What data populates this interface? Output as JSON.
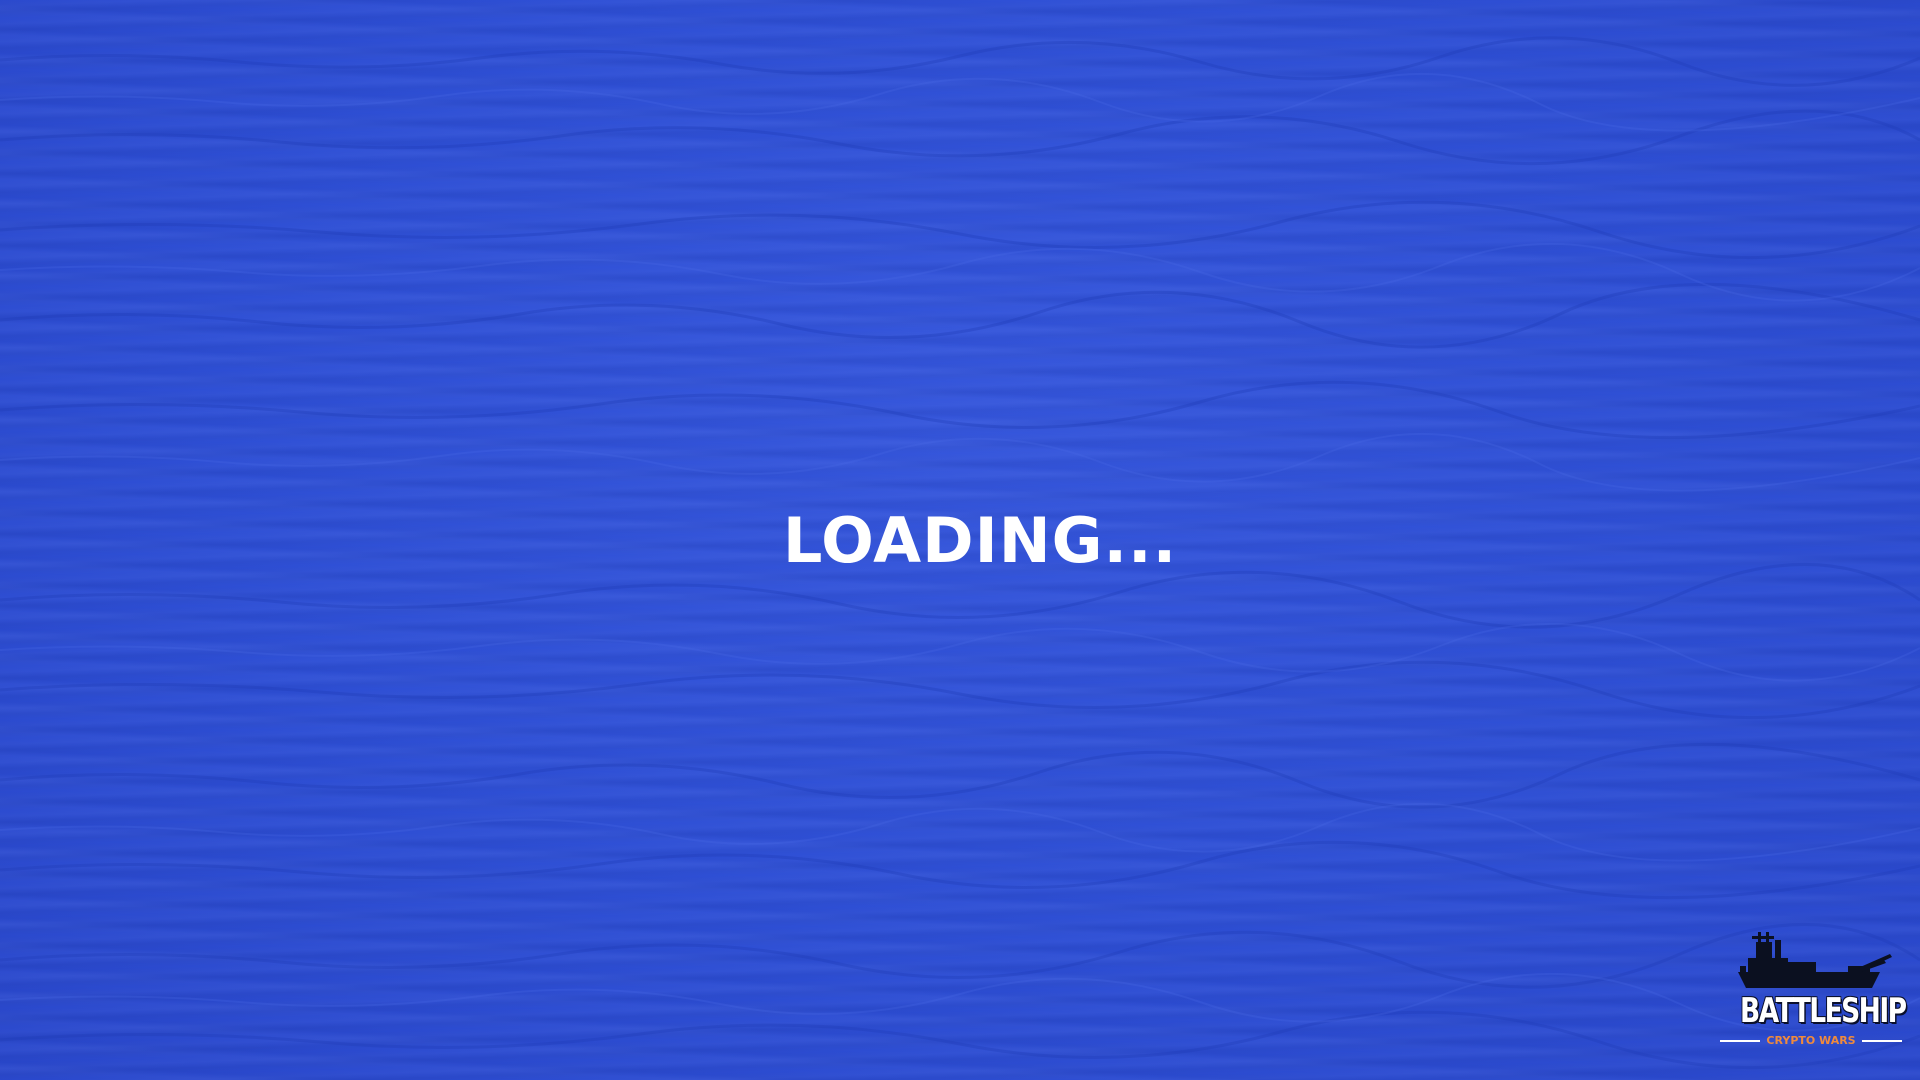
{
  "screen": {
    "background_color": "#2f4ed6",
    "loading_text": "LOADING...",
    "text_color": "#ffffff"
  },
  "logo": {
    "icon": "battleship-icon",
    "title": "BATTLESHIP",
    "subtitle": "CRYPTO WARS",
    "subtitle_color": "#f08a3c"
  }
}
